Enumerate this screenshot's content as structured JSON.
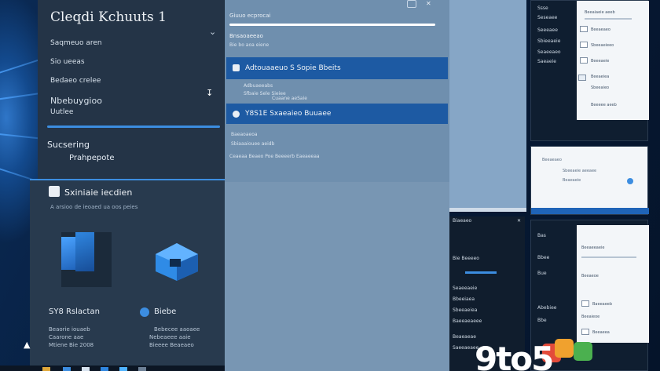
{
  "left_panel": {
    "title": "Cleqdi Kchuuts 1",
    "items": [
      "Saqmeuo aren",
      "Sio ueeas",
      "Bedaeo crelee",
      "Nbebuygioo",
      "Uutlee"
    ],
    "sub_title": "Sucsering",
    "sub_item": "Prahpepote"
  },
  "lower_block": {
    "header": "Sxiniaie iecdien",
    "subtitle": "A arsioo de ieoaed ua oos peies",
    "apps": [
      {
        "label": "SY8 Rslactan",
        "meta": [
          "Beaorie iouaeb",
          "Caarone aae",
          "Mtiene Bie 2008"
        ]
      },
      {
        "label": "Biebe",
        "meta": [
          "Bebecee aaoaee",
          "Nebeaeee aaie",
          "Bieeee Beaeaeo"
        ]
      }
    ]
  },
  "center_panel": {
    "top_label": "Giuuo ecprocai",
    "section_label": "Bnsaoaeeao",
    "section_sub": "Bie bo aoa eiene",
    "row1": "Adtouaaeuo S Sopie Bbeits",
    "row1_meta": [
      "Adbuaeeabs",
      "Sfbaie Sele Sieiee",
      "Cuaane aeSaie"
    ],
    "row2": "Y8S1E Sxaeaieo Buuaee",
    "row2_meta": [
      "Baeaoaeoa",
      "Sbiaaaiouee aeidb",
      "Ceaeaa Beaeo Poe Beeeerb Eaeaeeaa"
    ]
  },
  "right_windows": {
    "win1_sidebar": [
      "Ssse",
      "Seseaee",
      "Seeeaee",
      "Sbieeaeie",
      "Seaeeaeo",
      "Saeaeie"
    ],
    "win1_pane": [
      "Beeaiaeie aeeb",
      "Beeaeaeo",
      "Sbeeaeieeo",
      "Beeeaeie",
      "Beeaeiea",
      "Sbeeaieo",
      "Beeeee aeeb"
    ],
    "win2_text": [
      "Beeaeaeo",
      "Sbeeaeie aeeaee",
      "Beaeaeie"
    ],
    "win3": [
      "Biaeaeo",
      "Bie Beeeeo",
      "Seaeeaeie",
      "Bbeeiaea",
      "Sbeeaeiea",
      "Baeeaeaeee",
      "Beaeaeae",
      "Saeeaeaee"
    ],
    "win4_sidebar": [
      "Bas",
      "Bbee",
      "Bue",
      "Abebiee",
      "Bbe"
    ],
    "win4_pane": [
      "Beeaeeaeie",
      "Beeaeoe",
      "Baeeaeeb",
      "Beeaieoe",
      "Beeaeea",
      "Baeeaie"
    ]
  },
  "logo": {
    "text": "9to5"
  },
  "colors": {
    "accent": "#1d5aa3",
    "highlight": "#3c8de0",
    "dark_panel": "#243447",
    "light_panel": "#6f8fae"
  }
}
